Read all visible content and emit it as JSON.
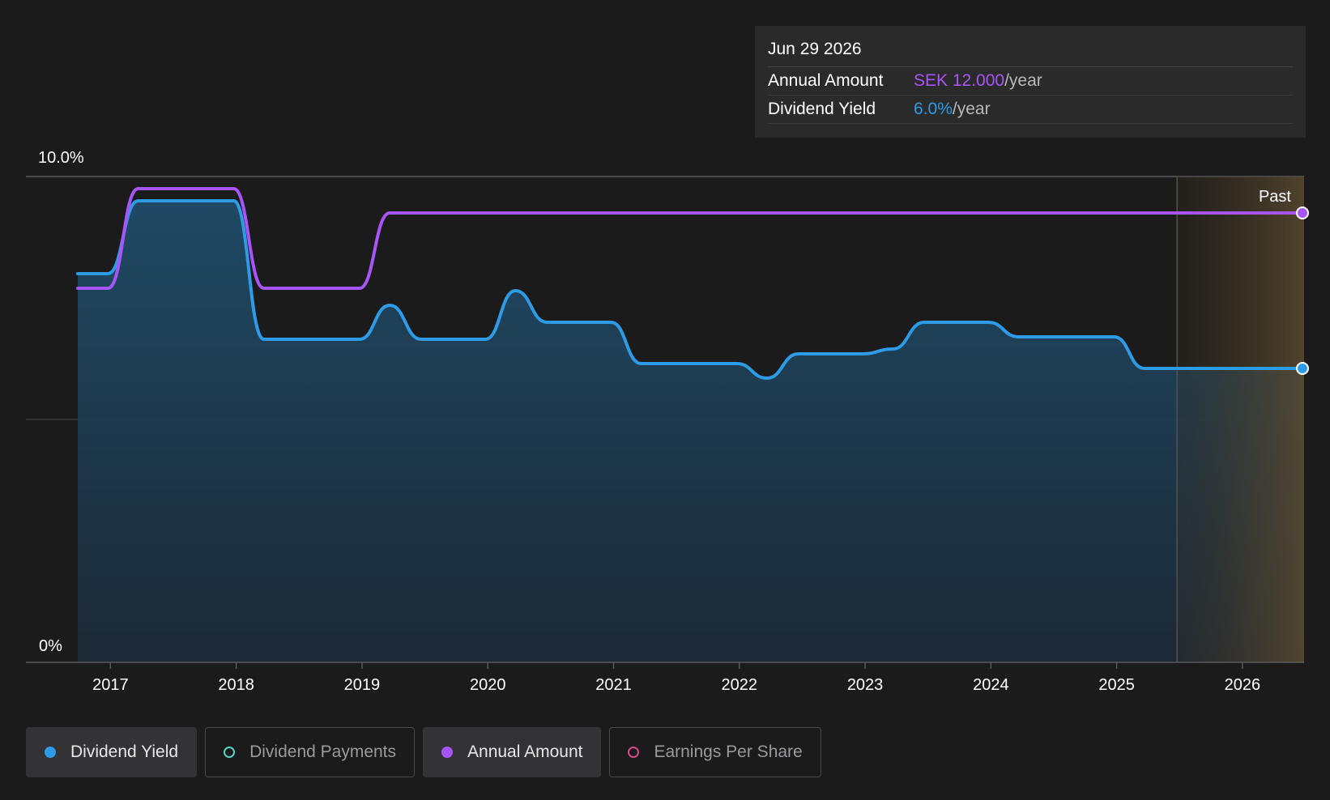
{
  "tooltip": {
    "date": "Jun 29 2026",
    "rows": [
      {
        "label": "Annual Amount",
        "value": "SEK 12.000",
        "unit": "/year",
        "color": "#a855f7"
      },
      {
        "label": "Dividend Yield",
        "value": "6.0%",
        "unit": "/year",
        "color": "#2e9be6"
      }
    ]
  },
  "legend": [
    {
      "label": "Dividend Yield",
      "color": "#2e9be6",
      "filled": true,
      "active": true
    },
    {
      "label": "Dividend Payments",
      "color": "#58d4c0",
      "filled": false,
      "active": false
    },
    {
      "label": "Annual Amount",
      "color": "#a855f7",
      "filled": true,
      "active": true
    },
    {
      "label": "Earnings Per Share",
      "color": "#d94a8c",
      "filled": false,
      "active": false
    }
  ],
  "chart_data": {
    "type": "line",
    "x_ticks": [
      "2017",
      "2018",
      "2019",
      "2020",
      "2021",
      "2022",
      "2023",
      "2024",
      "2025",
      "2026"
    ],
    "y_ticks": [
      "0%",
      "10.0%"
    ],
    "ylim": [
      0,
      10
    ],
    "xlim": [
      2016.74,
      2026.49
    ],
    "past_region_label": "Past",
    "past_region_start": 2025.48,
    "gridlines": [
      5,
      10
    ],
    "series": [
      {
        "name": "Dividend Yield",
        "color": "#2e9be6",
        "area": true,
        "points": [
          [
            2016.74,
            8.0
          ],
          [
            2016.98,
            8.0
          ],
          [
            2017.22,
            9.5
          ],
          [
            2017.98,
            9.5
          ],
          [
            2018.22,
            6.65
          ],
          [
            2018.98,
            6.65
          ],
          [
            2019.22,
            7.35
          ],
          [
            2019.47,
            6.65
          ],
          [
            2019.98,
            6.65
          ],
          [
            2020.22,
            7.65
          ],
          [
            2020.47,
            7.0
          ],
          [
            2020.98,
            7.0
          ],
          [
            2021.22,
            6.15
          ],
          [
            2021.98,
            6.15
          ],
          [
            2022.22,
            5.85
          ],
          [
            2022.47,
            6.35
          ],
          [
            2022.98,
            6.35
          ],
          [
            2023.22,
            6.45
          ],
          [
            2023.47,
            7.0
          ],
          [
            2023.98,
            7.0
          ],
          [
            2024.22,
            6.7
          ],
          [
            2024.98,
            6.7
          ],
          [
            2025.22,
            6.05
          ],
          [
            2026.49,
            6.05
          ]
        ]
      },
      {
        "name": "Annual Amount",
        "color": "#a855f7",
        "area": false,
        "points": [
          [
            2016.74,
            7.7
          ],
          [
            2016.98,
            7.7
          ],
          [
            2017.22,
            9.75
          ],
          [
            2017.98,
            9.75
          ],
          [
            2018.22,
            7.7
          ],
          [
            2018.98,
            7.7
          ],
          [
            2019.22,
            9.25
          ],
          [
            2026.49,
            9.25
          ]
        ]
      }
    ]
  }
}
